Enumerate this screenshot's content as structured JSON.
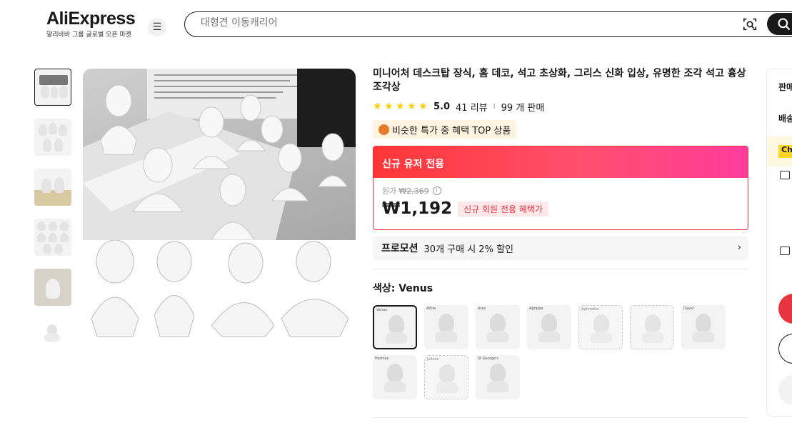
{
  "header": {
    "logo_text": "AliExpress",
    "logo_sub": "알리바바 그룹 글로벌 오픈 마켓",
    "search_placeholder": "대형견 이동캐리어"
  },
  "product": {
    "title": "미니어처 데스크탑 장식, 홈 데코, 석고 초상화, 그리스 신화 입상, 유명한 조각 석고 흉상 조각상",
    "rating": "5.0",
    "reviews": "41 리뷰",
    "separator": "I",
    "sold": "99 개 판매",
    "rating_stars": 5,
    "tag": "비슷한 특가 중 혜택 TOP 상품"
  },
  "deal": {
    "header": "신규 유저 전용",
    "orig_label": "원가",
    "orig_price": "₩2,369",
    "price": "₩1,192",
    "badge": "신규 회원 전용 혜택가"
  },
  "promo": {
    "label": "프로모션",
    "text": "30개 구매 시 2% 할인"
  },
  "color": {
    "label": "색상: Venus",
    "swatches": [
      "Venus",
      "Attila",
      "Ares",
      "Agrippa",
      "Aphrodite",
      "",
      "David",
      "Hermes",
      "Juliens",
      "St George's"
    ]
  },
  "side": {
    "item1": "판매",
    "item2": "배송",
    "badge": "Ch"
  },
  "colors": {
    "accent": "#e7343f",
    "star": "#fdcc0d",
    "dark": "#191919"
  }
}
